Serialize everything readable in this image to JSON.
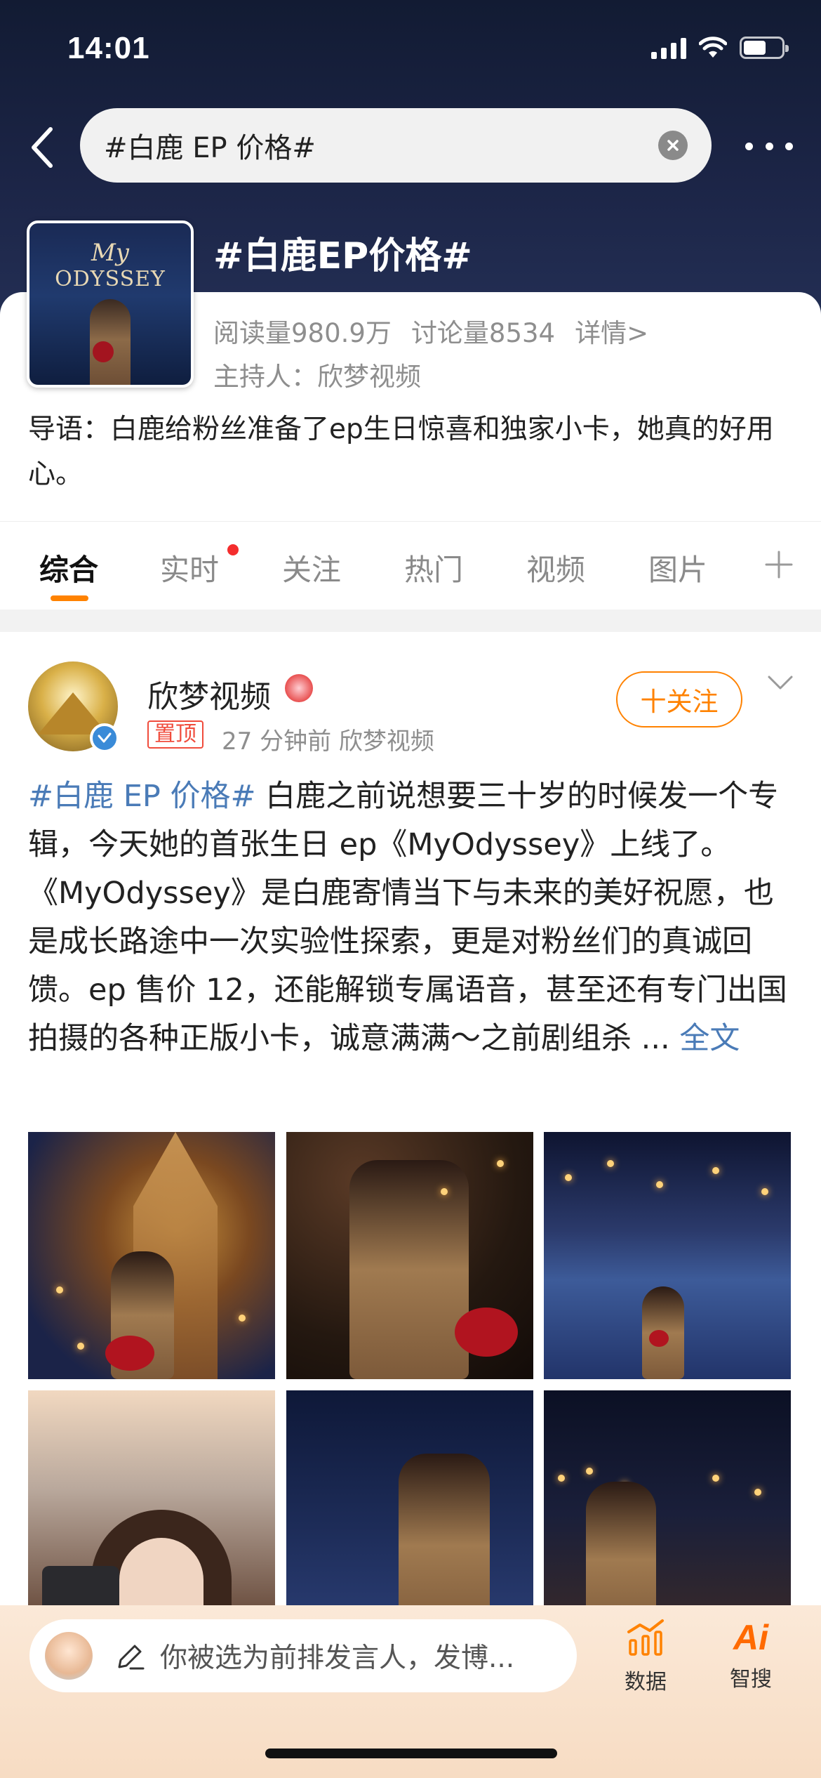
{
  "status_bar": {
    "time": "14:01",
    "battery_level": 0.6
  },
  "search": {
    "query": "#白鹿 EP 价格#"
  },
  "topic": {
    "cover_title_line1": "My",
    "cover_title_line2": "ODYSSEY",
    "title": "#白鹿EP价格#",
    "reads": "阅读量980.9万",
    "discussions": "讨论量8534",
    "details_link": "详情>",
    "host": "主持人：欣梦视频",
    "intro": "导语：白鹿给粉丝准备了ep生日惊喜和独家小卡，她真的好用心。"
  },
  "tabs": [
    "综合",
    "实时",
    "关注",
    "热门",
    "视频",
    "图片"
  ],
  "active_tab": "综合",
  "post": {
    "author": "欣梦视频",
    "pinned_label": "置顶",
    "meta": "27 分钟前  欣梦视频",
    "follow_label": "十关注",
    "hashtag": "#白鹿 EP 价格#",
    "body": " 白鹿之前说想要三十岁的时候发一个专辑，今天她的首张生日 ep《MyOdyssey》上线了。《MyOdyssey》是白鹿寄情当下与未来的美好祝愿，也是成长路途中一次实验性探索，更是对粉丝们的真诚回馈。ep 售价 12，还能解锁专属语音，甚至还有专门出国拍摄的各种正版小卡，诚意满满～之前剧组杀 ... ",
    "more_link": "全文",
    "image_count": 6
  },
  "bottom_bar": {
    "compose_placeholder": "你被选为前排发言人，发博...",
    "data_label": "数据",
    "ai_label": "智搜",
    "ai_icon_text": "Ai"
  },
  "colors": {
    "accent": "#ff8200",
    "link": "#4a7bb7",
    "header_bg": "#1c2547",
    "pinned": "#f04c3c"
  }
}
